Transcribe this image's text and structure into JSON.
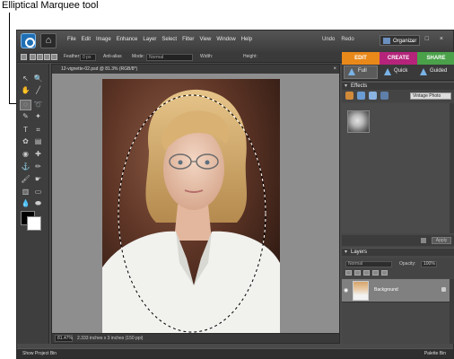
{
  "callout": {
    "label": "Elliptical Marquee tool"
  },
  "menu": [
    "File",
    "Edit",
    "Image",
    "Enhance",
    "Layer",
    "Select",
    "Filter",
    "View",
    "Window",
    "Help"
  ],
  "titlebar": {
    "undo": "Undo",
    "redo": "Redo",
    "organizer": "Organizer",
    "window_controls": "_ □ ×"
  },
  "options_bar": {
    "feather_label": "Feather:",
    "feather_value": "0 px",
    "antialias_label": "Anti-alias",
    "mode_label": "Mode:",
    "mode_value": "Normal",
    "width_label": "Width:",
    "height_label": "Height:"
  },
  "tabs": [
    "EDIT",
    "CREATE",
    "SHARE"
  ],
  "mode_buttons": [
    "Full",
    "Quick",
    "Guided"
  ],
  "document": {
    "title": "12-vignette-02.psd @ 81.3% (RGB/8*)",
    "zoom": "81.47%",
    "dims": "2.333 inches x 3 inches (150 ppi)"
  },
  "effects": {
    "title": "Effects",
    "dropdown": "Vintage Photo",
    "apply": "Apply"
  },
  "layers": {
    "title": "Layers",
    "blend_mode": "Normal",
    "opacity_label": "Opacity:",
    "opacity_value": "100%",
    "layer_name": "Background"
  },
  "bottombar": {
    "left": "Show Project Bin",
    "right": "Palette Bin"
  },
  "colors": {
    "edit_tab": "#e9891a",
    "create_tab": "#b5247a",
    "share_tab": "#4aa14a"
  }
}
